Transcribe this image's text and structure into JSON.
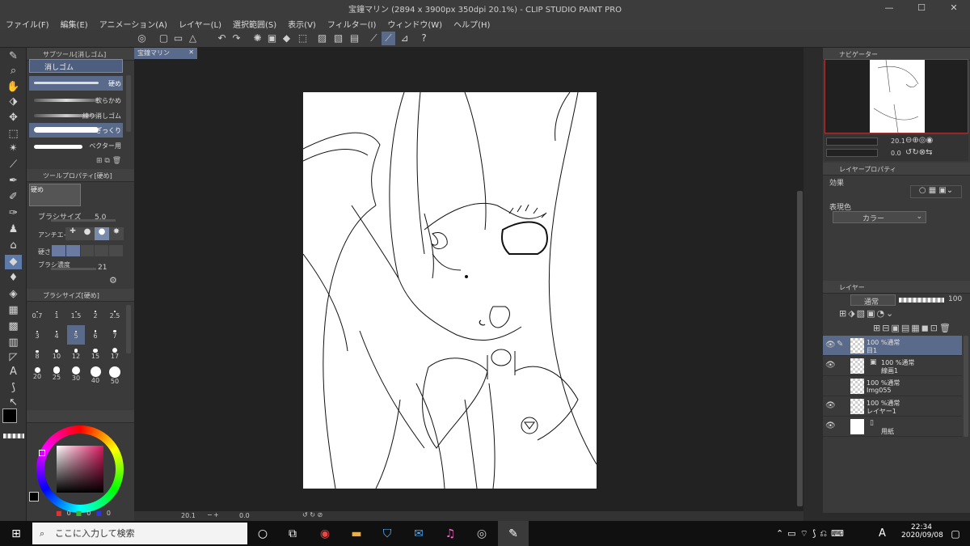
{
  "titlebar": {
    "title": "宝鐘マリン (2894 x 3900px 350dpi 20.1%)  - CLIP STUDIO PAINT PRO",
    "minimize": "—",
    "maximize": "☐",
    "close": "✕"
  },
  "menu": [
    "ファイル(F)",
    "編集(E)",
    "アニメーション(A)",
    "レイヤー(L)",
    "選択範囲(S)",
    "表示(V)",
    "フィルター(I)",
    "ウィンドウ(W)",
    "ヘルプ(H)"
  ],
  "canvas_tab": {
    "name": "宝鐘マリン",
    "close": "✕"
  },
  "subtool": {
    "header": "サブツール[消しゴム]",
    "group": "消しゴム",
    "items": [
      "硬め",
      "軟らかめ",
      "練り消しゴム",
      "ざっくり",
      "ベクター用"
    ]
  },
  "toolprop": {
    "header": "ツールプロパティ[硬め]",
    "preview_label": "硬め",
    "brush_size_label": "ブラシサイズ",
    "brush_size_value": "5.0",
    "antialias_label": "アンチエイリ",
    "hardness_label": "硬さ",
    "density_label": "ブラシ濃度",
    "density_value": "21"
  },
  "brushsize": {
    "header": "ブラシサイズ[硬め]",
    "sizes": [
      "0.7",
      "1",
      "1.5",
      "2",
      "2.5",
      "3",
      "4",
      "5",
      "6",
      "7",
      "8",
      "10",
      "12",
      "15",
      "17",
      "20",
      "25",
      "30",
      "40",
      "50"
    ],
    "selected": "5"
  },
  "colorbar": {
    "r": "0",
    "g": "0",
    "b": "0",
    "main_color": "#000000",
    "sub_color": "#ffffff"
  },
  "navigator": {
    "header": "ナビゲーター",
    "zoom": "20.1",
    "rotation": "0.0"
  },
  "layerprop": {
    "header": "レイヤープロパティ",
    "effect_label": "効果",
    "expression_label": "表現色",
    "expression_value": "カラー"
  },
  "layers": {
    "header": "レイヤー",
    "blend_mode": "通常",
    "opacity": "100",
    "items": [
      {
        "meta": "100 %通常",
        "name": "目1"
      },
      {
        "meta": "100 %通常",
        "name": "線画1"
      },
      {
        "meta": "100 %通常",
        "name": "Img055"
      },
      {
        "meta": "100 %通常",
        "name": "レイヤー1"
      },
      {
        "meta": "",
        "name": "用紙"
      }
    ]
  },
  "statusbar": {
    "zoom": "20.1",
    "angle": "0.0"
  },
  "taskbar": {
    "search_placeholder": "ここに入力して検索",
    "ime": "A",
    "time": "22:34",
    "date": "2020/09/08"
  },
  "colors": {
    "accent": "#5a6a8a",
    "panel": "#3a3a3a",
    "workspace": "#222222"
  }
}
